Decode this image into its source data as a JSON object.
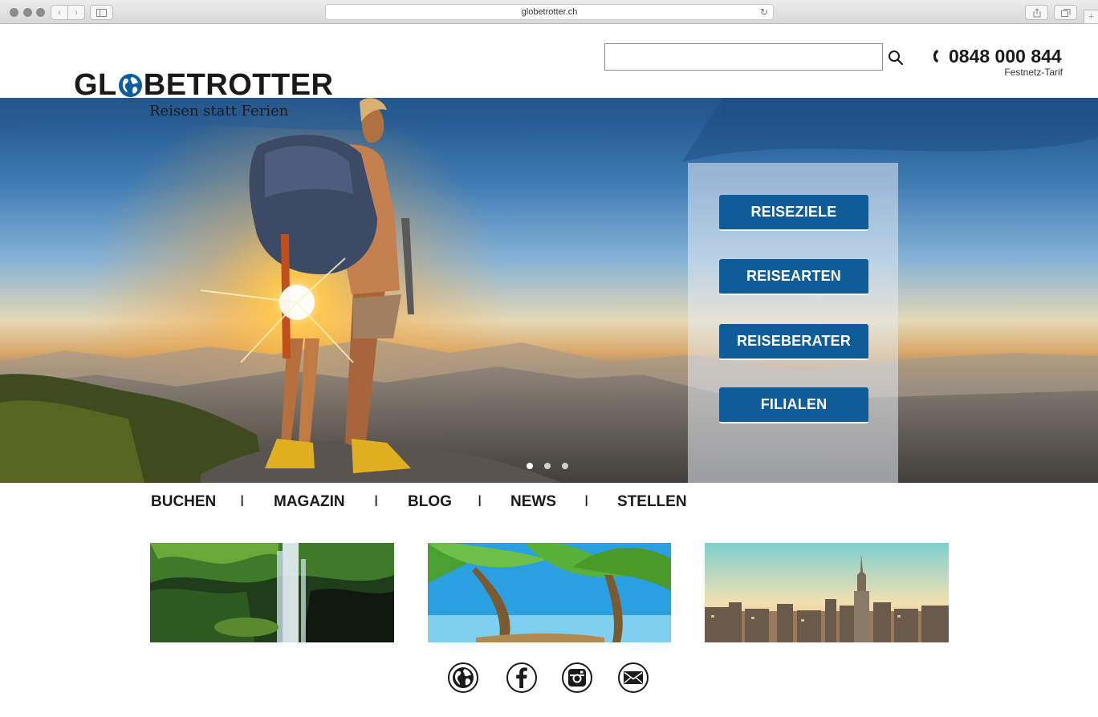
{
  "browser": {
    "url": "globetrotter.ch"
  },
  "header": {
    "logo_text_left": "GL",
    "logo_text_right": "BETROTTER",
    "tagline": "Reisen statt Ferien",
    "search": {
      "value": "",
      "placeholder": ""
    },
    "phone": "0848 000 844",
    "phone_note": "Festnetz-Tarif"
  },
  "hero": {
    "buttons": [
      "REISEZIELE",
      "REISEARTEN",
      "REISEBERATER",
      "FILIALEN"
    ],
    "slides": {
      "count": 3,
      "active": 1
    }
  },
  "nav": {
    "items": [
      "BUCHEN",
      "MAGAZIN",
      "BLOG",
      "NEWS",
      "STELLEN"
    ],
    "separator": "I"
  },
  "thumbnails": [
    "waterfall",
    "palm-beach",
    "city-skyline"
  ],
  "social": [
    "globe-icon",
    "facebook-icon",
    "instagram-icon",
    "mail-icon"
  ],
  "colors": {
    "brand_blue": "#0f5d98",
    "text": "#1a1a1a"
  }
}
